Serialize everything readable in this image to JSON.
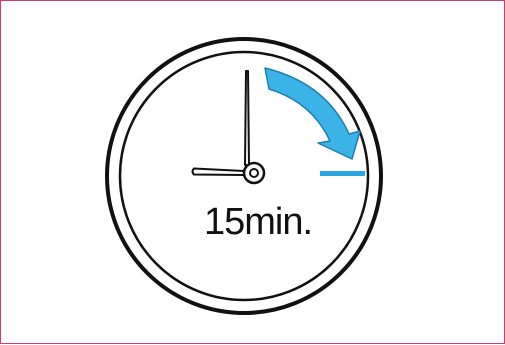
{
  "illustration": {
    "duration_label": "15min.",
    "icon": "clock-icon",
    "indicator_icon": "curved-arrow-icon",
    "colors": {
      "frame_border": "#d23a6a",
      "clock_outline": "#111111",
      "clock_face": "#ffffff",
      "arrow_fill": "#3bb3e6",
      "arrow_outline": "#1e7fb0",
      "marker": "#2aa7df"
    }
  }
}
